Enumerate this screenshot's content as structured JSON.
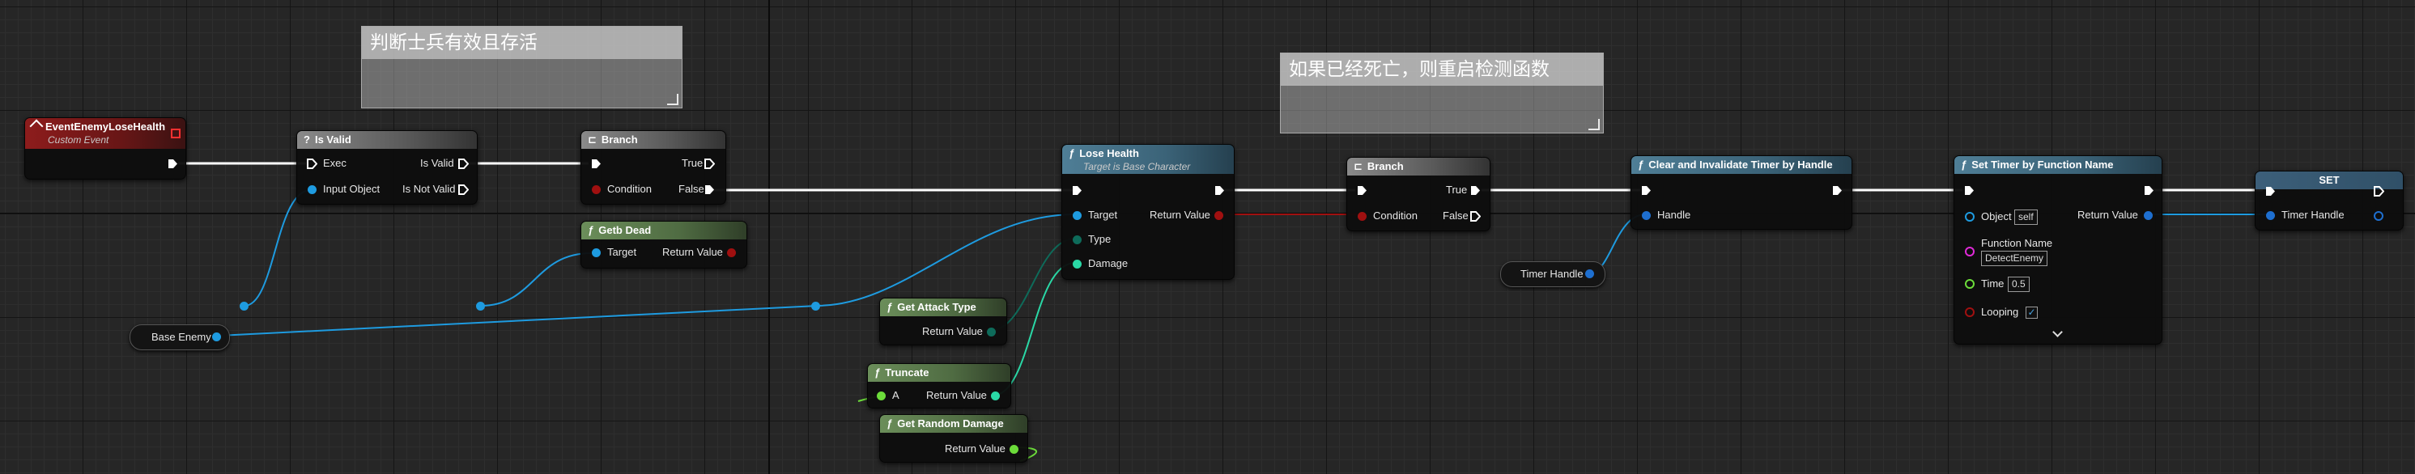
{
  "comments": {
    "check_soldier": "判断士兵有效且存活",
    "restart_detect": "如果已经死亡，则重启检测函数"
  },
  "nodes": {
    "event": {
      "title": "EventEnemyLoseHealth",
      "subtitle": "Custom Event"
    },
    "is_valid": {
      "title": "Is Valid",
      "exec": "Exec",
      "is_valid": "Is Valid",
      "input_object": "Input Object",
      "is_not_valid": "Is Not Valid"
    },
    "branch1": {
      "title": "Branch",
      "true": "True",
      "condition": "Condition",
      "false": "False"
    },
    "get_dead": {
      "title": "Getb Dead",
      "target": "Target",
      "return_value": "Return Value"
    },
    "base_enemy": {
      "label": "Base Enemy"
    },
    "lose_health": {
      "title": "Lose Health",
      "subtitle": "Target is Base Character",
      "target": "Target",
      "return_value": "Return Value",
      "type": "Type",
      "damage": "Damage"
    },
    "get_attack_type": {
      "title": "Get Attack Type",
      "return_value": "Return Value"
    },
    "truncate": {
      "title": "Truncate",
      "a": "A",
      "return_value": "Return Value"
    },
    "get_random_damage": {
      "title": "Get Random Damage",
      "return_value": "Return Value"
    },
    "branch2": {
      "title": "Branch",
      "true": "True",
      "condition": "Condition",
      "false": "False"
    },
    "clear_timer": {
      "title": "Clear and Invalidate Timer by Handle",
      "handle": "Handle"
    },
    "timer_handle_var": {
      "label": "Timer Handle"
    },
    "set_timer": {
      "title": "Set Timer by Function Name",
      "object": "Object",
      "object_value": "self",
      "return_value": "Return Value",
      "function_name": "Function Name",
      "function_name_value": "DetectEnemy",
      "time": "Time",
      "time_value": "0.5",
      "looping": "Looping",
      "looping_checked": "✓"
    },
    "set_node": {
      "title": "SET",
      "timer_handle": "Timer Handle"
    }
  },
  "colors": {
    "exec": "#ffffff",
    "object": "#1e9be0",
    "bool": "#a01010",
    "byte": "#0e6b5a",
    "int": "#2ad8a6",
    "float": "#6cdc3a",
    "string": "#e02ad8",
    "struct": "#0d4ea8"
  }
}
